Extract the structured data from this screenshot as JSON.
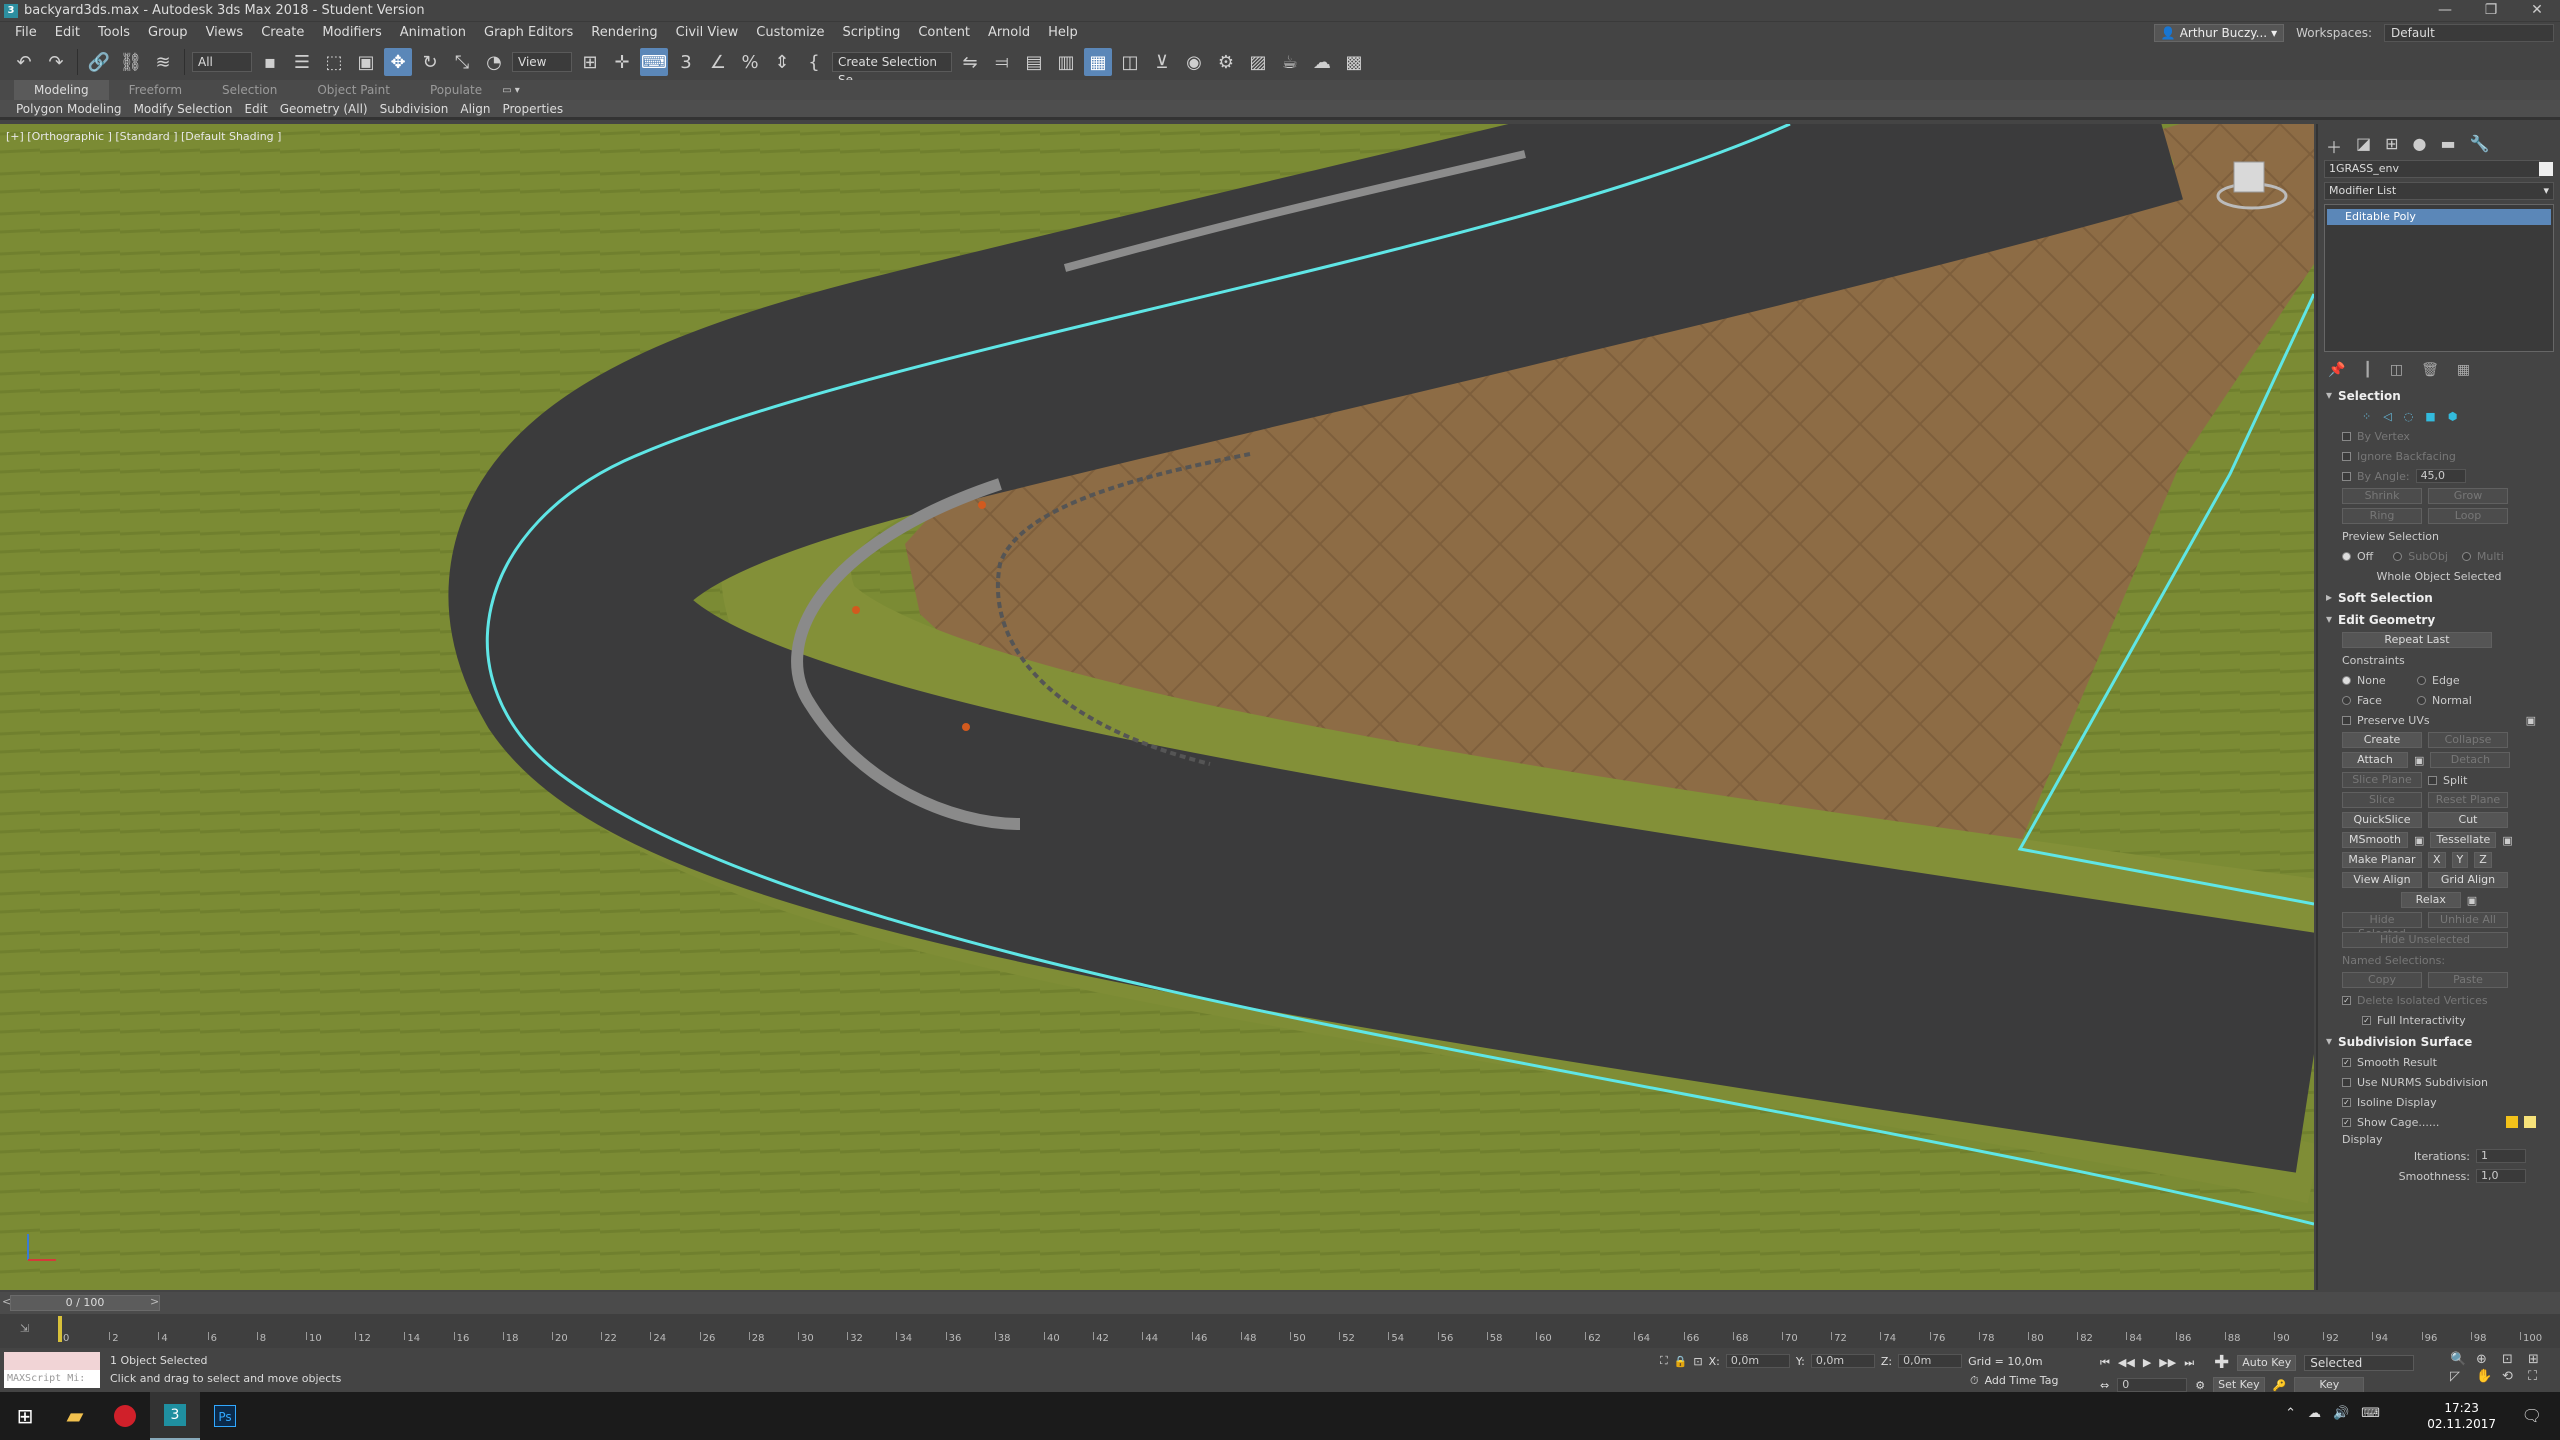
{
  "window": {
    "title": "backyard3ds.max - Autodesk 3ds Max 2018 - Student Version",
    "controls": [
      "—",
      "❐",
      "✕"
    ]
  },
  "menu": {
    "items": [
      "File",
      "Edit",
      "Tools",
      "Group",
      "Views",
      "Create",
      "Modifiers",
      "Animation",
      "Graph Editors",
      "Rendering",
      "Civil View",
      "Customize",
      "Scripting",
      "Content",
      "Arnold",
      "Help"
    ],
    "user": "Arthur Buczy...",
    "workspaces_label": "Workspaces:",
    "workspace": "Default"
  },
  "toolbar": {
    "filter": "All",
    "ref_coord": "View",
    "selection_set": "Create Selection Se"
  },
  "ribbon": {
    "tabs": [
      "Modeling",
      "Freeform",
      "Selection",
      "Object Paint",
      "Populate"
    ],
    "sub": [
      "Polygon Modeling",
      "Modify Selection",
      "Edit",
      "Geometry (All)",
      "Subdivision",
      "Align",
      "Properties"
    ]
  },
  "viewport": {
    "label": "[+] [Orthographic ] [Standard ] [Default Shading ]",
    "colors": {
      "grass": "#7a8a33",
      "asphalt": "#3a3a3a",
      "dirt": "#8a6a44",
      "highlight": "#57e8e8"
    }
  },
  "command_panel": {
    "object_name": "1GRASS_env",
    "modifier_list": "Modifier List",
    "stack_item": "Editable Poly",
    "selection": {
      "title": "Selection",
      "by_vertex": "By Vertex",
      "ignore_backfacing": "Ignore Backfacing",
      "by_angle": "By Angle:",
      "by_angle_val": "45,0",
      "shrink": "Shrink",
      "grow": "Grow",
      "ring": "Ring",
      "loop": "Loop",
      "preview": "Preview Selection",
      "off": "Off",
      "subobj": "SubObj",
      "multi": "Multi",
      "status": "Whole Object Selected"
    },
    "soft_selection": "Soft Selection",
    "edit_geometry": {
      "title": "Edit Geometry",
      "repeat_last": "Repeat Last",
      "constraints": "Constraints",
      "none": "None",
      "edge": "Edge",
      "face": "Face",
      "normal": "Normal",
      "preserve_uvs": "Preserve UVs",
      "create": "Create",
      "collapse": "Collapse",
      "attach": "Attach",
      "detach": "Detach",
      "slice_plane": "Slice Plane",
      "split": "Split",
      "slice": "Slice",
      "reset_plane": "Reset Plane",
      "quickslice": "QuickSlice",
      "cut": "Cut",
      "msmooth": "MSmooth",
      "tessellate": "Tessellate",
      "make_planar": "Make Planar",
      "x": "X",
      "y": "Y",
      "z": "Z",
      "view_align": "View Align",
      "grid_align": "Grid Align",
      "relax": "Relax",
      "hide_selected": "Hide Selected",
      "unhide_all": "Unhide All",
      "hide_unselected": "Hide Unselected",
      "named_selections": "Named Selections:",
      "copy": "Copy",
      "paste": "Paste",
      "delete_isolated": "Delete Isolated Vertices",
      "full_interactivity": "Full Interactivity"
    },
    "subdivision": {
      "title": "Subdivision Surface",
      "smooth_result": "Smooth Result",
      "use_nurms": "Use NURMS Subdivision",
      "isoline": "Isoline Display",
      "show_cage": "Show Cage......",
      "display": "Display",
      "iterations_label": "Iterations:",
      "iterations": "1",
      "smoothness_label": "Smoothness:",
      "smoothness": "1,0"
    }
  },
  "timeline": {
    "frame": "0 / 100",
    "ticks": [
      "0",
      "2",
      "4",
      "6",
      "8",
      "10",
      "12",
      "14",
      "16",
      "18",
      "20",
      "22",
      "24",
      "26",
      "28",
      "30",
      "32",
      "34",
      "36",
      "38",
      "40",
      "42",
      "44",
      "46",
      "48",
      "50",
      "52",
      "54",
      "56",
      "58",
      "60",
      "62",
      "64",
      "66",
      "68",
      "70",
      "72",
      "74",
      "76",
      "78",
      "80",
      "82",
      "84",
      "86",
      "88",
      "90",
      "92",
      "94",
      "96",
      "98",
      "100"
    ]
  },
  "status": {
    "maxscript": "MAXScript Mi:",
    "line1": "1 Object Selected",
    "line2": "Click and drag to select and move objects",
    "x_label": "X:",
    "x": "0,0m",
    "y_label": "Y:",
    "y": "0,0m",
    "z_label": "Z:",
    "z": "0,0m",
    "grid": "Grid = 10,0m",
    "add_time_tag": "Add Time Tag",
    "auto_key": "Auto Key",
    "auto_key_mode": "Selected",
    "set_key": "Set Key",
    "key_filters": "Key Filters...",
    "frame_field": "0"
  },
  "taskbar": {
    "time": "17:23",
    "date": "02.11.2017"
  }
}
